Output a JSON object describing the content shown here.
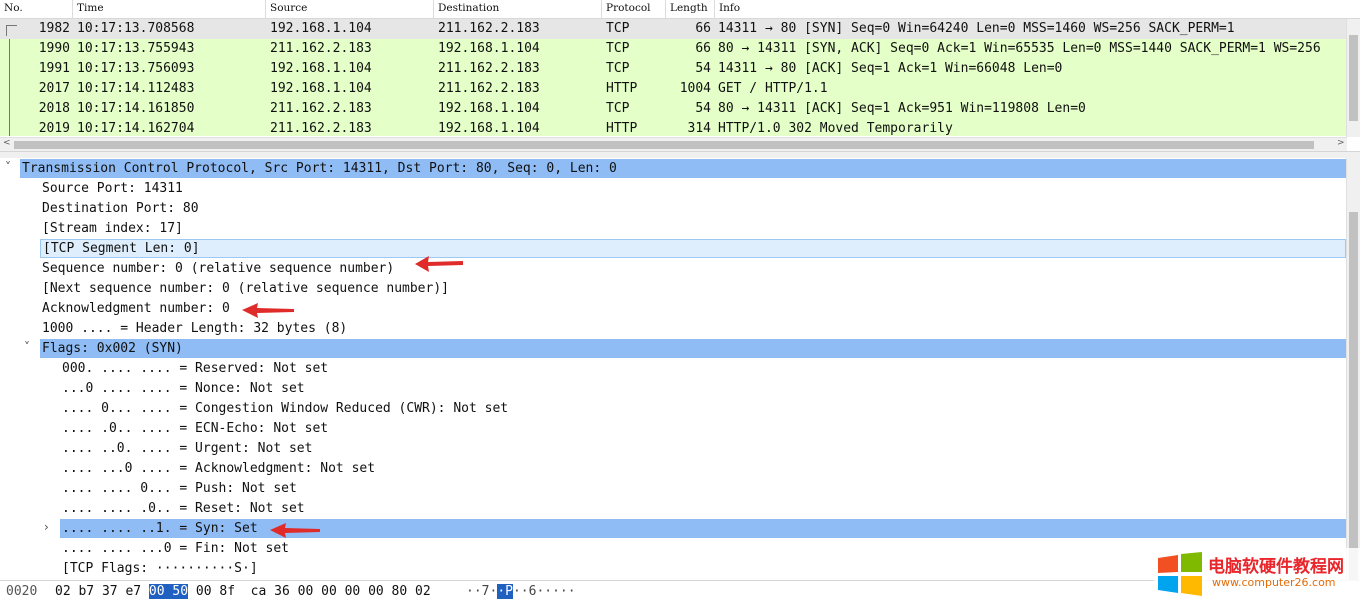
{
  "packet_list": {
    "columns": [
      "No.",
      "Time",
      "Source",
      "Destination",
      "Protocol",
      "Length",
      "Info"
    ],
    "rows": [
      {
        "no": "1982",
        "time": "10:17:13.708568",
        "source": "192.168.1.104",
        "destination": "211.162.2.183",
        "protocol": "TCP",
        "length": "66",
        "info": "14311 → 80 [SYN] Seq=0 Win=64240 Len=0 MSS=1460 WS=256 SACK_PERM=1"
      },
      {
        "no": "1990",
        "time": "10:17:13.755943",
        "source": "211.162.2.183",
        "destination": "192.168.1.104",
        "protocol": "TCP",
        "length": "66",
        "info": "80 → 14311 [SYN, ACK] Seq=0 Ack=1 Win=65535 Len=0 MSS=1440 SACK_PERM=1 WS=256"
      },
      {
        "no": "1991",
        "time": "10:17:13.756093",
        "source": "192.168.1.104",
        "destination": "211.162.2.183",
        "protocol": "TCP",
        "length": "54",
        "info": "14311 → 80 [ACK] Seq=1 Ack=1 Win=66048 Len=0"
      },
      {
        "no": "2017",
        "time": "10:17:14.112483",
        "source": "192.168.1.104",
        "destination": "211.162.2.183",
        "protocol": "HTTP",
        "length": "1004",
        "info": "GET / HTTP/1.1"
      },
      {
        "no": "2018",
        "time": "10:17:14.161850",
        "source": "211.162.2.183",
        "destination": "192.168.1.104",
        "protocol": "TCP",
        "length": "54",
        "info": "80 → 14311 [ACK] Seq=1 Ack=951 Win=119808 Len=0"
      },
      {
        "no": "2019",
        "time": "10:17:14.162704",
        "source": "211.162.2.183",
        "destination": "192.168.1.104",
        "protocol": "HTTP",
        "length": "314",
        "info": "HTTP/1.0 302 Moved Temporarily"
      }
    ],
    "colors": {
      "selected": "#e6e6e6",
      "tcp_http": "#e4ffc7"
    }
  },
  "details": {
    "header": "Transmission Control Protocol, Src Port: 14311, Dst Port: 80, Seq: 0, Len: 0",
    "fields": [
      "Source Port: 14311",
      "Destination Port: 80",
      "[Stream index: 17]",
      "[TCP Segment Len: 0]",
      "Sequence number: 0    (relative sequence number)",
      "[Next sequence number: 0    (relative sequence number)]",
      "Acknowledgment number: 0",
      "1000 .... = Header Length: 32 bytes (8)"
    ],
    "flags_header": "Flags: 0x002 (SYN)",
    "flags": [
      "000. .... .... = Reserved: Not set",
      "...0 .... .... = Nonce: Not set",
      ".... 0... .... = Congestion Window Reduced (CWR): Not set",
      ".... .0.. .... = ECN-Echo: Not set",
      ".... ..0. .... = Urgent: Not set",
      ".... ...0 .... = Acknowledgment: Not set",
      ".... .... 0... = Push: Not set",
      ".... .... .0.. = Reset: Not set",
      ".... .... ..1. = Syn: Set",
      ".... .... ...0 = Fin: Not set",
      "[TCP Flags: ··········S·]"
    ],
    "highlight_color": "#8fbcf5"
  },
  "bytes": {
    "offset": "0020",
    "hex_before": "02 b7 37 e7",
    "hex_selected": "00 50",
    "hex_after": "00 8f  ca 36 00 00 00 00 80 02",
    "ascii_before": "··7·",
    "ascii_selected": "·P",
    "ascii_after": "··6·····"
  },
  "watermark": {
    "title": "电脑软硬件教程网",
    "url": "www.computer26.com"
  }
}
